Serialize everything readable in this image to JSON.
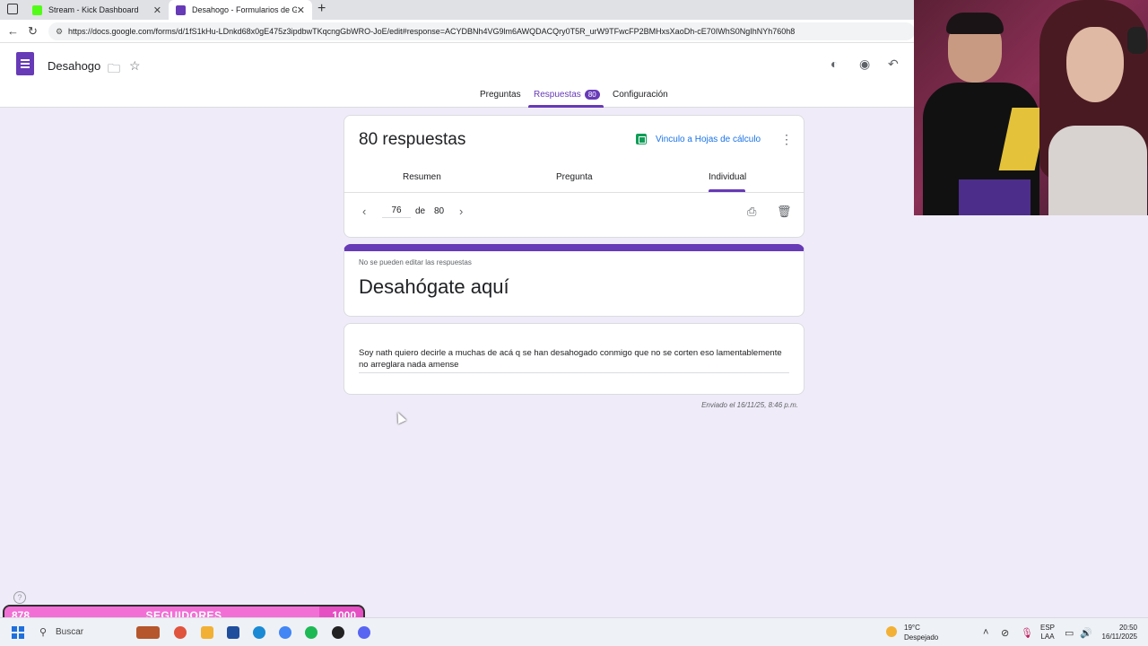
{
  "browser": {
    "tabs": [
      {
        "title": "Stream - Kick Dashboard",
        "favicon_color": "#53fc18",
        "active": false
      },
      {
        "title": "Desahogo - Formularios de Goog",
        "favicon_color": "#673ab7",
        "active": true
      }
    ],
    "url": "https://docs.google.com/forms/d/1fS1kHu-LDnkd68x0gE475z3ipdbwTKqcngGbWRO-JoE/edit#response=ACYDBNh4VG9lm6AWQDACQry0T5R_urW9TFwcFP2BMHxsXaoDh-cE70IWhS0NgIhNYh760h8"
  },
  "form": {
    "doc_title": "Desahogo",
    "nav": {
      "preguntas": "Preguntas",
      "respuestas": "Respuestas",
      "respuestas_badge": "80",
      "configuracion": "Configuración"
    },
    "responses": {
      "count_label": "80 respuestas",
      "sheets_link": "Vinculo a Hojas de cálculo",
      "subtabs": {
        "resumen": "Resumen",
        "pregunta": "Pregunta",
        "individual": "Individual"
      },
      "pager": {
        "current": "76",
        "of_label": "de",
        "total": "80"
      }
    },
    "response_card": {
      "readonly_note": "No se pueden editar las respuestas",
      "title": "Desahógate aquí",
      "answer": "Soy nath quiero decirle a muchas de acá q se han desahogado conmigo que no se corten eso lamentablemente no arreglara nada amense",
      "submitted": "Enviado el 16/11/25, 8:46 p.m."
    },
    "accent_color": "#673ab7"
  },
  "overlay": {
    "followers": {
      "current": "878",
      "label": "SEGUIDORES",
      "goal": "1000",
      "progress": 0.878
    }
  },
  "taskbar": {
    "search_placeholder": "Buscar",
    "weather": {
      "temp": "19°C",
      "condition": "Despejado"
    },
    "lang": {
      "line1": "ESP",
      "line2": "LAA"
    },
    "clock": {
      "time": "20:50",
      "date": "16/11/2025"
    }
  }
}
